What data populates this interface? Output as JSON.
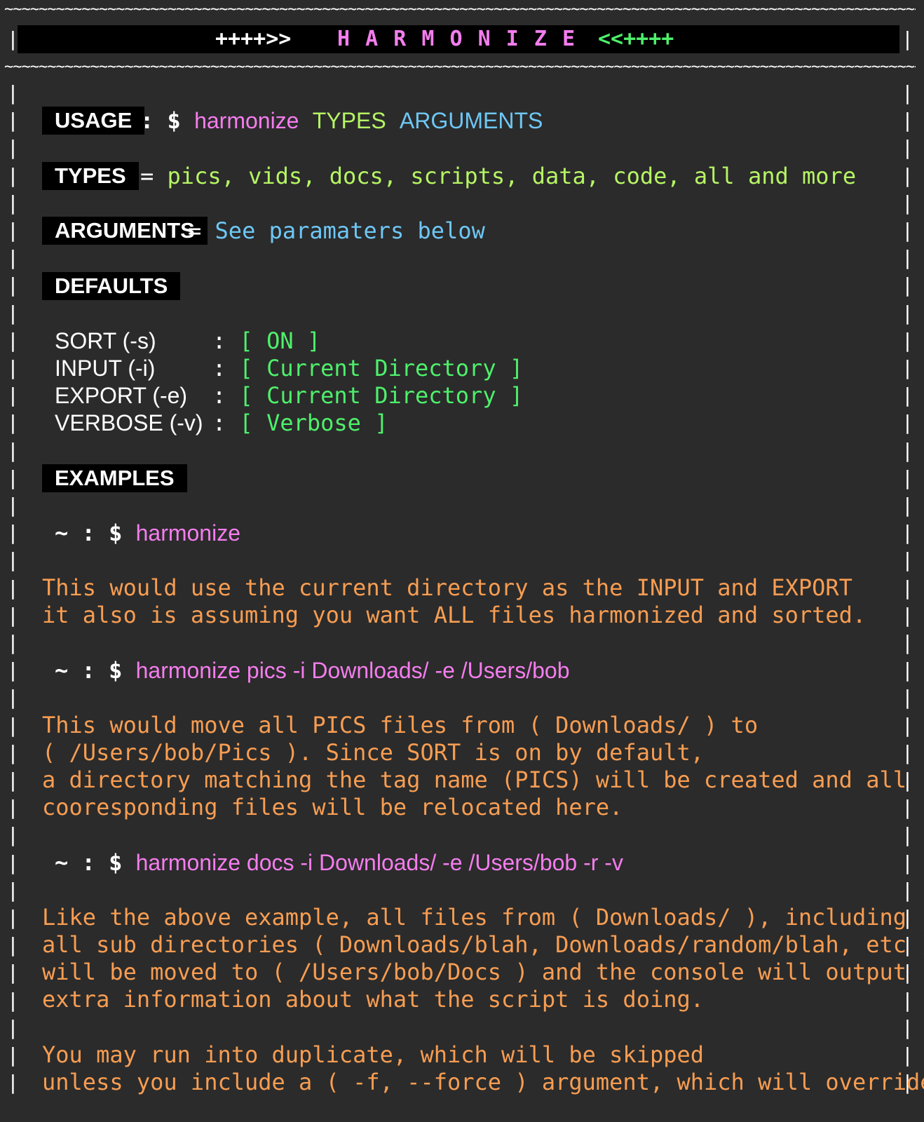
{
  "border": {
    "tilde_line": "~~~~~~~~~~~~~~~~~~~~~~~~~~~~~~~~~~~~~~~~~~~~~~~~~~~~~~~~~~~~~~~~~~~~~~~~~~~~~~~~~~~~~~~~~~~~~~~~~~~~~~~~~~~~~~~~~~~~~~~~~~~~~~~",
    "pipe": "|"
  },
  "title": {
    "left_arrows": "++++>>",
    "text": "H A R M O N I Z E",
    "right_arrows": "<<++++"
  },
  "usage": {
    "label": "USAGE",
    "sep": ": $",
    "cmd": "harmonize",
    "types": "TYPES",
    "args": "ARGUMENTS"
  },
  "types": {
    "label": "TYPES",
    "sep": "=",
    "value": "pics, vids, docs, scripts, data, code, all and more"
  },
  "arguments": {
    "label": "ARGUMENTS",
    "sep": "=",
    "value": "See paramaters below"
  },
  "defaults": {
    "label": "DEFAULTS",
    "rows": [
      {
        "key": "SORT (-s)",
        "pad": "    ",
        "colon": ":",
        "value": "[ ON ]"
      },
      {
        "key": "INPUT (-i)",
        "pad": "   ",
        "colon": ":",
        "value": "[ Current Directory ]"
      },
      {
        "key": "EXPORT (-e)",
        "pad": "  ",
        "colon": ":",
        "value": "[ Current Directory ]"
      },
      {
        "key": "VERBOSE (-v)",
        "pad": " ",
        "colon": ":",
        "value": "[ Verbose ]"
      }
    ]
  },
  "examples": {
    "label": "EXAMPLES",
    "prompt": "~ : $",
    "ex1": {
      "cmd": "harmonize",
      "desc": [
        "This would use the current directory as the INPUT and EXPORT",
        "it also is assuming you want ALL files harmonized and sorted."
      ]
    },
    "ex2": {
      "cmd": "harmonize pics -i Downloads/ -e /Users/bob",
      "desc": [
        "This would move all PICS files from ( Downloads/ ) to",
        "( /Users/bob/Pics ). Since SORT is on by default,",
        "a directory matching the tag name (PICS) will be created and all",
        "cooresponding files will be relocated here."
      ]
    },
    "ex3": {
      "cmd": "harmonize docs -i Downloads/ -e /Users/bob -r -v",
      "desc": [
        "Like the above example, all files from ( Downloads/ ), including",
        "all sub directories ( Downloads/blah, Downloads/random/blah, etc )",
        "will be moved to ( /Users/bob/Docs ) and the console will output",
        "extra information about what the script is doing."
      ]
    },
    "note": [
      "You may run into duplicate, which will be skipped",
      "unless you include a ( -f, --force ) argument, which will override"
    ]
  },
  "colors": {
    "background": "#2b2b2b",
    "pink": "#f57dee",
    "green": "#b6f564",
    "blue": "#6ec7f5",
    "light_green": "#4ef06b",
    "orange": "#f79d52"
  }
}
